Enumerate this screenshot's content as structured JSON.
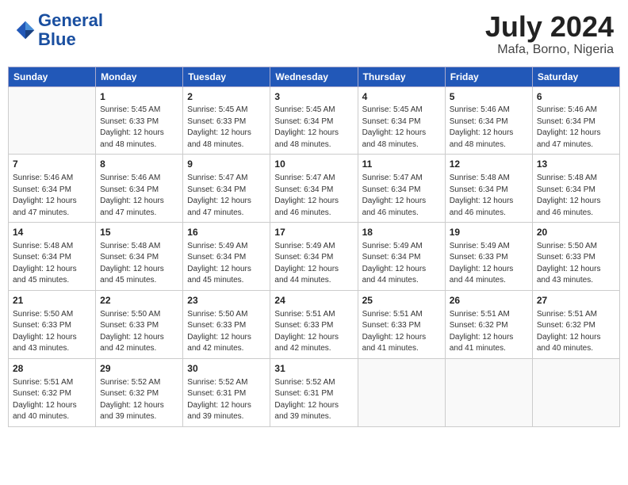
{
  "header": {
    "logo_line1": "General",
    "logo_line2": "Blue",
    "month_year": "July 2024",
    "location": "Mafa, Borno, Nigeria"
  },
  "weekdays": [
    "Sunday",
    "Monday",
    "Tuesday",
    "Wednesday",
    "Thursday",
    "Friday",
    "Saturday"
  ],
  "weeks": [
    [
      {
        "day": "",
        "info": ""
      },
      {
        "day": "1",
        "info": "Sunrise: 5:45 AM\nSunset: 6:33 PM\nDaylight: 12 hours\nand 48 minutes."
      },
      {
        "day": "2",
        "info": "Sunrise: 5:45 AM\nSunset: 6:33 PM\nDaylight: 12 hours\nand 48 minutes."
      },
      {
        "day": "3",
        "info": "Sunrise: 5:45 AM\nSunset: 6:34 PM\nDaylight: 12 hours\nand 48 minutes."
      },
      {
        "day": "4",
        "info": "Sunrise: 5:45 AM\nSunset: 6:34 PM\nDaylight: 12 hours\nand 48 minutes."
      },
      {
        "day": "5",
        "info": "Sunrise: 5:46 AM\nSunset: 6:34 PM\nDaylight: 12 hours\nand 48 minutes."
      },
      {
        "day": "6",
        "info": "Sunrise: 5:46 AM\nSunset: 6:34 PM\nDaylight: 12 hours\nand 47 minutes."
      }
    ],
    [
      {
        "day": "7",
        "info": "Sunrise: 5:46 AM\nSunset: 6:34 PM\nDaylight: 12 hours\nand 47 minutes."
      },
      {
        "day": "8",
        "info": "Sunrise: 5:46 AM\nSunset: 6:34 PM\nDaylight: 12 hours\nand 47 minutes."
      },
      {
        "day": "9",
        "info": "Sunrise: 5:47 AM\nSunset: 6:34 PM\nDaylight: 12 hours\nand 47 minutes."
      },
      {
        "day": "10",
        "info": "Sunrise: 5:47 AM\nSunset: 6:34 PM\nDaylight: 12 hours\nand 46 minutes."
      },
      {
        "day": "11",
        "info": "Sunrise: 5:47 AM\nSunset: 6:34 PM\nDaylight: 12 hours\nand 46 minutes."
      },
      {
        "day": "12",
        "info": "Sunrise: 5:48 AM\nSunset: 6:34 PM\nDaylight: 12 hours\nand 46 minutes."
      },
      {
        "day": "13",
        "info": "Sunrise: 5:48 AM\nSunset: 6:34 PM\nDaylight: 12 hours\nand 46 minutes."
      }
    ],
    [
      {
        "day": "14",
        "info": "Sunrise: 5:48 AM\nSunset: 6:34 PM\nDaylight: 12 hours\nand 45 minutes."
      },
      {
        "day": "15",
        "info": "Sunrise: 5:48 AM\nSunset: 6:34 PM\nDaylight: 12 hours\nand 45 minutes."
      },
      {
        "day": "16",
        "info": "Sunrise: 5:49 AM\nSunset: 6:34 PM\nDaylight: 12 hours\nand 45 minutes."
      },
      {
        "day": "17",
        "info": "Sunrise: 5:49 AM\nSunset: 6:34 PM\nDaylight: 12 hours\nand 44 minutes."
      },
      {
        "day": "18",
        "info": "Sunrise: 5:49 AM\nSunset: 6:34 PM\nDaylight: 12 hours\nand 44 minutes."
      },
      {
        "day": "19",
        "info": "Sunrise: 5:49 AM\nSunset: 6:33 PM\nDaylight: 12 hours\nand 44 minutes."
      },
      {
        "day": "20",
        "info": "Sunrise: 5:50 AM\nSunset: 6:33 PM\nDaylight: 12 hours\nand 43 minutes."
      }
    ],
    [
      {
        "day": "21",
        "info": "Sunrise: 5:50 AM\nSunset: 6:33 PM\nDaylight: 12 hours\nand 43 minutes."
      },
      {
        "day": "22",
        "info": "Sunrise: 5:50 AM\nSunset: 6:33 PM\nDaylight: 12 hours\nand 42 minutes."
      },
      {
        "day": "23",
        "info": "Sunrise: 5:50 AM\nSunset: 6:33 PM\nDaylight: 12 hours\nand 42 minutes."
      },
      {
        "day": "24",
        "info": "Sunrise: 5:51 AM\nSunset: 6:33 PM\nDaylight: 12 hours\nand 42 minutes."
      },
      {
        "day": "25",
        "info": "Sunrise: 5:51 AM\nSunset: 6:33 PM\nDaylight: 12 hours\nand 41 minutes."
      },
      {
        "day": "26",
        "info": "Sunrise: 5:51 AM\nSunset: 6:32 PM\nDaylight: 12 hours\nand 41 minutes."
      },
      {
        "day": "27",
        "info": "Sunrise: 5:51 AM\nSunset: 6:32 PM\nDaylight: 12 hours\nand 40 minutes."
      }
    ],
    [
      {
        "day": "28",
        "info": "Sunrise: 5:51 AM\nSunset: 6:32 PM\nDaylight: 12 hours\nand 40 minutes."
      },
      {
        "day": "29",
        "info": "Sunrise: 5:52 AM\nSunset: 6:32 PM\nDaylight: 12 hours\nand 39 minutes."
      },
      {
        "day": "30",
        "info": "Sunrise: 5:52 AM\nSunset: 6:31 PM\nDaylight: 12 hours\nand 39 minutes."
      },
      {
        "day": "31",
        "info": "Sunrise: 5:52 AM\nSunset: 6:31 PM\nDaylight: 12 hours\nand 39 minutes."
      },
      {
        "day": "",
        "info": ""
      },
      {
        "day": "",
        "info": ""
      },
      {
        "day": "",
        "info": ""
      }
    ]
  ]
}
